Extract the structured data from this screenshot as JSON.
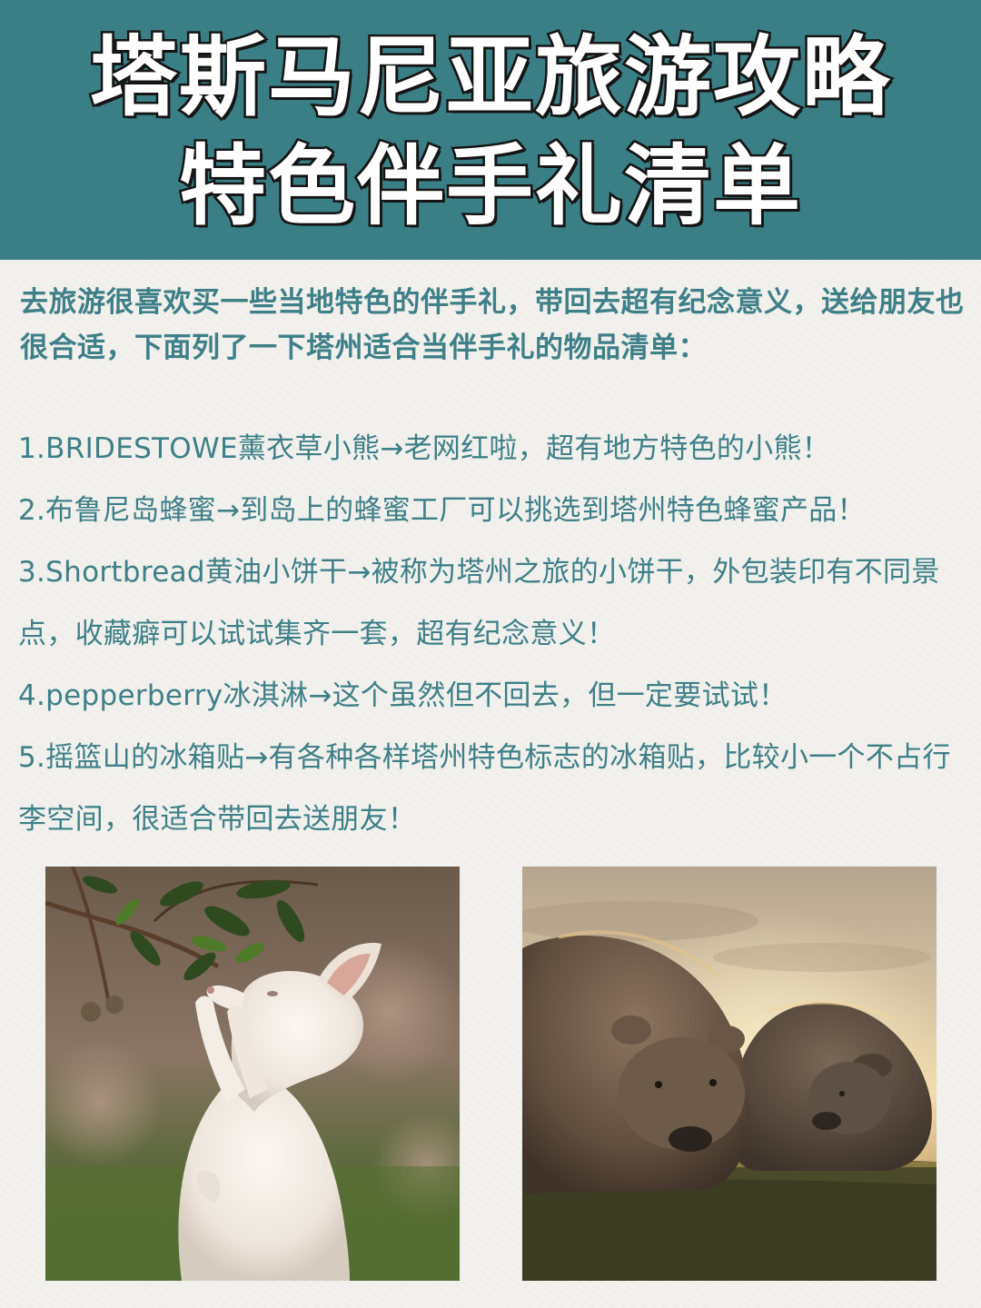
{
  "header": {
    "title_line_1": "塔斯马尼亚旅游攻略",
    "title_line_2": "特色伴手礼清单",
    "bg_color": "#3b7f86"
  },
  "intro": {
    "text": "去旅游很喜欢买一些当地特色的伴手礼，带回去超有纪念意义，送给朋友也很合适，下面列了一下塔州适合当伴手礼的物品清单："
  },
  "items": [
    "1.BRIDESTOWE薰衣草小熊→老网红啦，超有地方特色的小熊！",
    "2.布鲁尼岛蜂蜜→到岛上的蜂蜜工厂可以挑选到塔州特色蜂蜜产品！",
    "3.Shortbread黄油小饼干→被称为塔州之旅的小饼干，外包装印有不同景点，收藏癖可以试试集齐一套，超有纪念意义！",
    "4.pepperberry冰淇淋→这个虽然但不回去，但一定要试试！",
    "5.摇篮山的冰箱贴→有各种各样塔州特色标志的冰箱贴，比较小一个不占行李空间，很适合带回去送朋友！"
  ],
  "text_color": "#3e7f88",
  "photos": [
    {
      "subject": "white-wallaby-photo"
    },
    {
      "subject": "wombats-photo"
    }
  ]
}
